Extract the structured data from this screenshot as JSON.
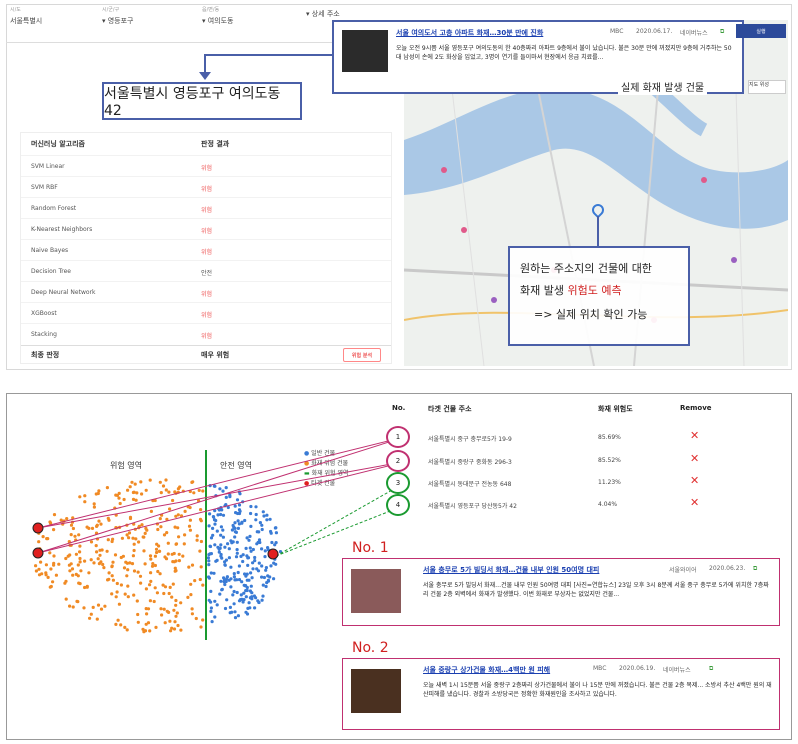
{
  "top": {
    "selects": [
      {
        "label": "시/도",
        "value": "서울특별시"
      },
      {
        "label": "시/군/구",
        "value": "▾ 영등포구"
      },
      {
        "label": "읍/면/동",
        "value": "▾ 여의도동"
      },
      {
        "label": "",
        "value": "▾ 상세 주소"
      }
    ],
    "address": "서울특별시 영등포구 여의도동 42",
    "ml_header_algo": "머신러닝 알고리즘",
    "ml_header_result": "판정 결과",
    "ml_rows": [
      {
        "name": "SVM Linear",
        "result": "위험"
      },
      {
        "name": "SVM RBF",
        "result": "위험"
      },
      {
        "name": "Random Forest",
        "result": "위험"
      },
      {
        "name": "K-Nearest Neighbors",
        "result": "위험"
      },
      {
        "name": "Naive Bayes",
        "result": "위험"
      },
      {
        "name": "Decision Tree",
        "result": "안전"
      },
      {
        "name": "Deep Neural Network",
        "result": "위험"
      },
      {
        "name": "XGBoost",
        "result": "위험"
      },
      {
        "name": "Stacking",
        "result": "위험"
      }
    ],
    "final_label": "최종 판정",
    "final_value": "매우 위험",
    "final_button": "위험 분석",
    "news": {
      "title": "서울 여의도서 고층 아파트 화재…30분 만에 진화",
      "source": "MBC",
      "date": "2020.06.17.",
      "portal": "네이버뉴스",
      "body": "오늘 오전 9시쯤 서울 영등포구 여의도동의 한 40층짜리 아파트 9층에서 불이 났습니다. 불은 30분 만에 꺼졌지만 9층에 거주하는 50대 남성이 손에 2도 화상을 입었고, 3명이 연기를 들이마셔 현장에서 응급 치료를..."
    },
    "caption_right": "실제 화재 발생 건물",
    "blue_button": "실행",
    "zoom": "지도 위성",
    "callout_line1": "원하는 주소지의 건물에 대한",
    "callout_line2a": "화재 발생 ",
    "callout_line2b": "위험도 예측",
    "callout_line3": "=> 실제 위치 확인 가능"
  },
  "bottom": {
    "zone_danger": "위험 영역",
    "zone_safe": "안전 영역",
    "legend": [
      "일반 건물",
      "화재 위험 건물",
      "화재 위험 영역",
      "타겟 건물"
    ],
    "headers": {
      "no": "No.",
      "addr": "타겟 건물 주소",
      "risk": "화재 위험도",
      "remove": "Remove"
    },
    "rows": [
      {
        "no": "1",
        "addr": "서울특별시 중구 충무로5가 19-9",
        "pct": "85.69%",
        "rm": "✕"
      },
      {
        "no": "2",
        "addr": "서울특별시 중랑구 중화동 296-3",
        "pct": "85.52%",
        "rm": "✕"
      },
      {
        "no": "3",
        "addr": "서울특별시 동대문구 전농동 648",
        "pct": "11.23%",
        "rm": "✕"
      },
      {
        "no": "4",
        "addr": "서울특별시 영등포구 당산동5가 42",
        "pct": "4.04%",
        "rm": "✕"
      }
    ],
    "no1": "No. 1",
    "news1": {
      "title": "서울 충무로 5가 빌딩서 화재…건물 내부 인원 50여명 대피",
      "source": "서울와이어",
      "date": "2020.06.23.",
      "body": "서울 충무로 5가 빌딩서 화재…건물 내부 인원 50여명 대피 [사진=연합뉴스] 23일 오후 3시 8분께 서울 중구 충무로 5가에 위치한 7층짜리 건물 2층 외벽에서 화재가 발생했다. 이번 화재로 부상자는 없었지만 건물..."
    },
    "no2": "No. 2",
    "news2": {
      "title": "서울 중랑구 상가건물 화재…4백만 원 피해",
      "source": "MBC",
      "date": "2020.06.19.",
      "portal": "네이버뉴스",
      "body": "오늘 새벽 1시 15분쯤 서울 중랑구 2층짜리 상가건물에서 불이 나 15분 만에 꺼졌습니다. 불은 건물 2층 복제... 소방서 추산 4백만 원의 재산피해를 냈습니다. 경찰과 소방당국은 정확한 화재원인을 조사하고 있습니다."
    }
  },
  "colors": {
    "accent": "#4a5fa8",
    "danger": "#d02020",
    "orange": "#f08a24",
    "blue": "#3a7bd5",
    "green": "#1a9a30",
    "magenta": "#c03070"
  }
}
